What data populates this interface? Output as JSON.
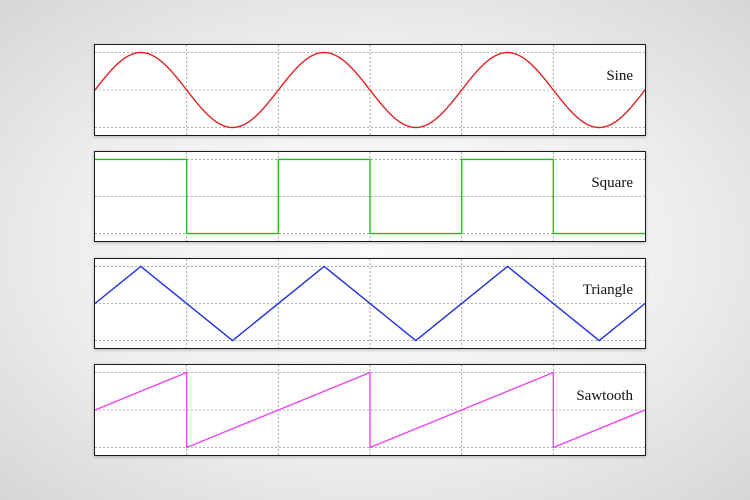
{
  "chart_data": [
    {
      "type": "line",
      "title": "Sine",
      "waveform": "sine",
      "color": "#dd2222",
      "periods": 3,
      "x": [
        0,
        0.5,
        1,
        1.5,
        2,
        2.5,
        3,
        3.5,
        4,
        4.5,
        5,
        5.5,
        6
      ],
      "y": [
        0,
        1,
        0,
        -1,
        0,
        1,
        0,
        -1,
        0,
        1,
        0,
        -1,
        0
      ],
      "xlim": [
        0,
        6
      ],
      "ylim": [
        -1.2,
        1.2
      ],
      "grid": true
    },
    {
      "type": "line",
      "title": "Square",
      "waveform": "square",
      "color": "#22bb22",
      "periods": 3,
      "x": [
        0,
        1,
        1,
        2,
        2,
        3,
        3,
        4,
        4,
        5,
        5,
        6
      ],
      "y": [
        1,
        1,
        -1,
        -1,
        1,
        1,
        -1,
        -1,
        1,
        1,
        -1,
        -1
      ],
      "xlim": [
        0,
        6
      ],
      "ylim": [
        -1.2,
        1.2
      ],
      "grid": true
    },
    {
      "type": "line",
      "title": "Triangle",
      "waveform": "triangle",
      "color": "#2233dd",
      "periods": 3,
      "x": [
        0,
        0.5,
        1.5,
        2.5,
        3.5,
        4.5,
        5.5,
        6
      ],
      "y": [
        0,
        1,
        -1,
        1,
        -1,
        1,
        -1,
        0
      ],
      "xlim": [
        0,
        6
      ],
      "ylim": [
        -1.2,
        1.2
      ],
      "grid": true
    },
    {
      "type": "line",
      "title": "Sawtooth",
      "waveform": "sawtooth",
      "color": "#ee44ee",
      "periods": 3,
      "x": [
        0,
        1,
        1,
        3,
        3,
        5,
        5,
        6
      ],
      "y": [
        0,
        1,
        -1,
        1,
        -1,
        1,
        -1,
        0
      ],
      "xlim": [
        0,
        6
      ],
      "ylim": [
        -1.2,
        1.2
      ],
      "grid": true
    }
  ]
}
